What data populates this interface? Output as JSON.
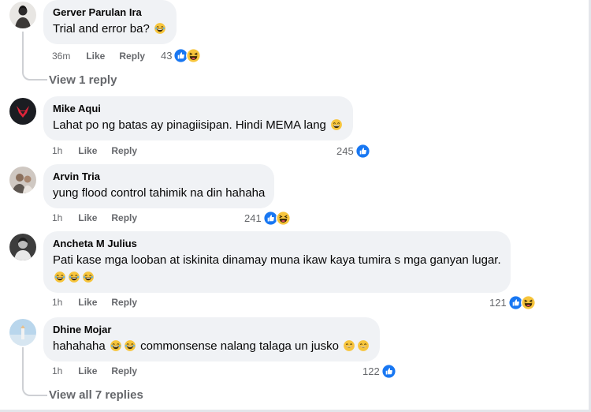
{
  "comments": [
    {
      "author": "Gerver Parulan Ira",
      "text": "Trial and error ba?",
      "time": "36m",
      "like": "Like",
      "reply": "Reply",
      "reaction_count": "43"
    },
    {
      "author": "Mike Aqui",
      "text": "Lahat po ng batas ay pinagiisipan. Hindi MEMA lang",
      "time": "1h",
      "like": "Like",
      "reply": "Reply",
      "reaction_count": "245"
    },
    {
      "author": "Arvin Tria",
      "text": "yung flood control tahimik na din hahaha",
      "time": "1h",
      "like": "Like",
      "reply": "Reply",
      "reaction_count": "241"
    },
    {
      "author": "Ancheta M Julius",
      "text": "Pati kase mga looban at iskinita dinamay muna ikaw kaya tumira s mga ganyan lugar.",
      "time": "1h",
      "like": "Like",
      "reply": "Reply",
      "reaction_count": "121"
    },
    {
      "author": "Dhine Mojar",
      "text_before": "hahahaha",
      "text_after": "commonsense nalang talaga un jusko",
      "time": "1h",
      "like": "Like",
      "reply": "Reply",
      "reaction_count": "122"
    }
  ],
  "view_replies": "View 1 reply",
  "view_all_replies": "View all 7 replies",
  "colors": {
    "bubble": "#f0f2f5",
    "meta_text": "#65676b",
    "like_blue": "#1877f2",
    "emoji_yellow": "#f7c53c"
  },
  "icons": [
    "like-reaction-icon",
    "haha-reaction-icon",
    "laughing-tears-emoji",
    "grinning-emoji",
    "smiling-emoji"
  ]
}
